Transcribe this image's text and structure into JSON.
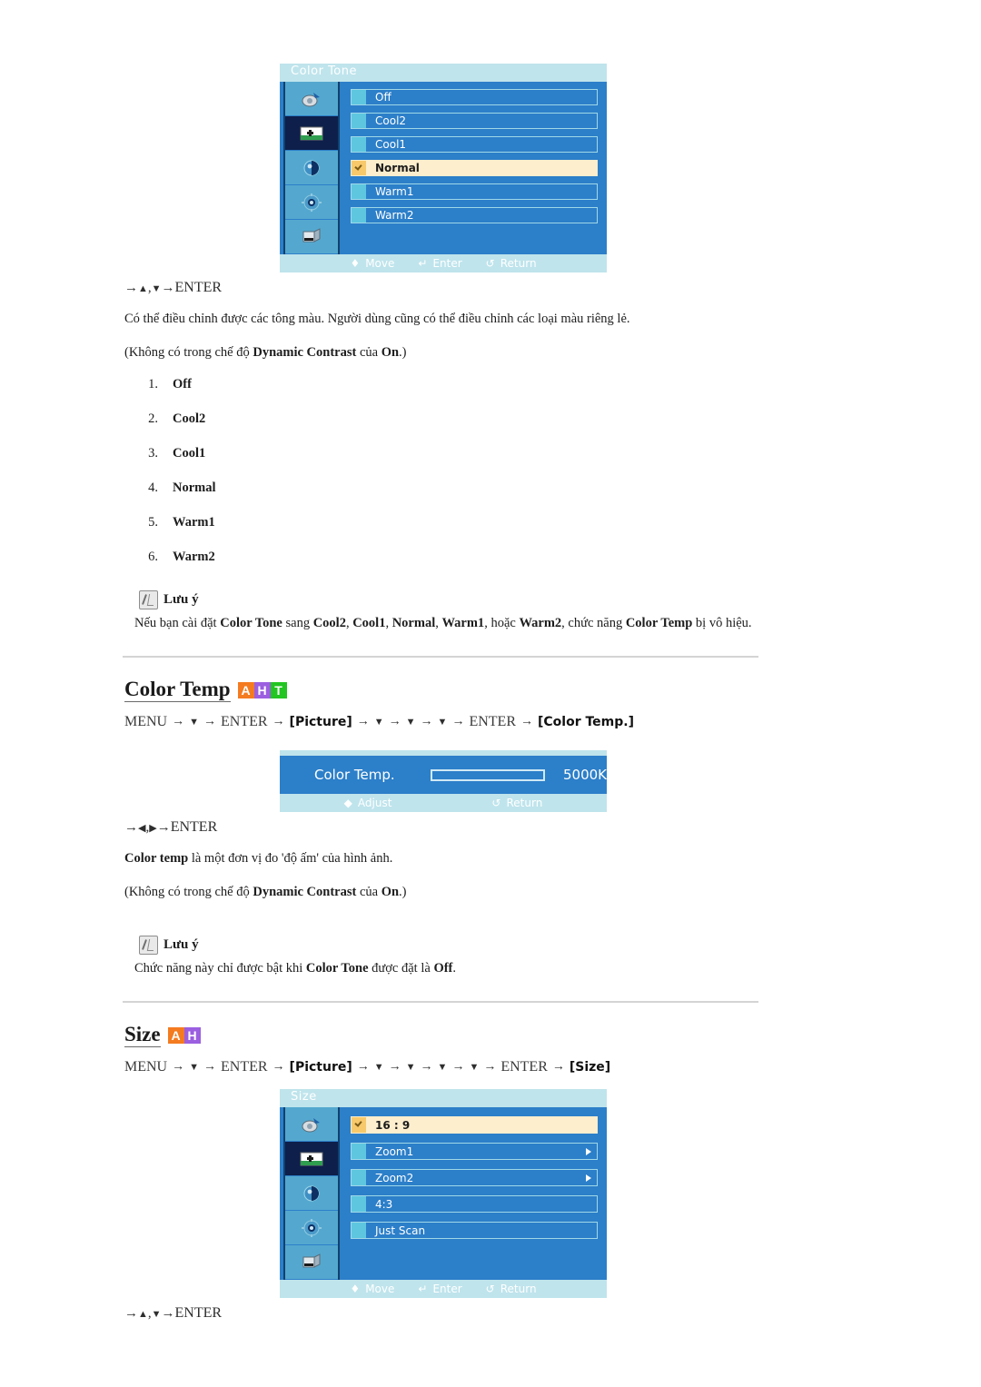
{
  "osd_color_tone": {
    "title": "Color Tone",
    "items": [
      {
        "label": "Off",
        "selected": false,
        "submenu": false
      },
      {
        "label": "Cool2",
        "selected": false,
        "submenu": false
      },
      {
        "label": "Cool1",
        "selected": false,
        "submenu": false
      },
      {
        "label": "Normal",
        "selected": true,
        "submenu": false
      },
      {
        "label": "Warm1",
        "selected": false,
        "submenu": false
      },
      {
        "label": "Warm2",
        "selected": false,
        "submenu": false
      }
    ],
    "sidebar_icons": [
      {
        "name": "input-source-icon",
        "selected": false
      },
      {
        "name": "picture-icon",
        "selected": true
      },
      {
        "name": "sound-icon",
        "selected": false
      },
      {
        "name": "setup-icon",
        "selected": false
      },
      {
        "name": "multi-control-icon",
        "selected": false
      }
    ],
    "footer": [
      {
        "glyph": "♦",
        "label": "Move"
      },
      {
        "glyph": "↵",
        "label": "Enter"
      },
      {
        "glyph": "↺",
        "label": "Return"
      }
    ]
  },
  "color_tone_section": {
    "nav_line": {
      "arrow": "→",
      "up": "▲",
      "sep": ",",
      "down": "▼",
      "arrow2": "→",
      "enter": "ENTER"
    },
    "paragraph1": "Có thể điều chỉnh được các tông màu. Người dùng cũng có thể điều chỉnh các loại màu riêng lẻ.",
    "paragraph2_pre": "(Không có trong chế độ ",
    "paragraph2_b1": "Dynamic Contrast",
    "paragraph2_mid": " của ",
    "paragraph2_b2": "On",
    "paragraph2_post": ".)",
    "list": [
      {
        "n": "1.",
        "t": "Off"
      },
      {
        "n": "2.",
        "t": "Cool2"
      },
      {
        "n": "3.",
        "t": "Cool1"
      },
      {
        "n": "4.",
        "t": "Normal"
      },
      {
        "n": "5.",
        "t": "Warm1"
      },
      {
        "n": "6.",
        "t": "Warm2"
      }
    ],
    "note_label": "Lưu ý",
    "note_pre": "Nếu bạn cài đặt ",
    "note_b1": "Color Tone",
    "note_m1": " sang ",
    "note_b2": "Cool2",
    "note_m2": ", ",
    "note_b3": "Cool1",
    "note_m3": ", ",
    "note_b4": "Normal",
    "note_m4": ", ",
    "note_b5": "Warm1",
    "note_m5": ", hoặc ",
    "note_b6": "Warm2",
    "note_m6": ", chức năng ",
    "note_b7": "Color Temp",
    "note_post": " bị vô hiệu."
  },
  "color_temp_section": {
    "title": "Color Temp",
    "badges": [
      {
        "letter": "A",
        "color": "#F47B20"
      },
      {
        "letter": "H",
        "color": "#9B5FE0"
      },
      {
        "letter": "T",
        "color": "#22C522"
      }
    ],
    "menu_path": {
      "menu": "MENU",
      "enter1": "ENTER",
      "picture": "[Picture]",
      "enter2": "ENTER",
      "target": "[Color Temp.]",
      "down_count_1": 1,
      "down_count_2": 3
    },
    "osd": {
      "label": "Color  Temp.",
      "value": "5000K",
      "footer": [
        {
          "glyph": "◆",
          "label": "Adjust"
        },
        {
          "glyph": "↺",
          "label": "Return"
        }
      ]
    },
    "nav_line": {
      "arrow": "→",
      "left": "◀",
      "sep": ",",
      "right": "▶",
      "arrow2": "→",
      "enter": "ENTER"
    },
    "paragraph1_b": "Color temp",
    "paragraph1_rest": " là một đơn vị đo 'độ ấm' của hình ảnh.",
    "paragraph2_pre": "(Không có trong chế độ ",
    "paragraph2_b1": "Dynamic Contrast",
    "paragraph2_mid": " của ",
    "paragraph2_b2": "On",
    "paragraph2_post": ".)",
    "note_label": "Lưu ý",
    "note_pre": "Chức năng này chỉ được bật khi ",
    "note_b1": "Color Tone",
    "note_mid": " được đặt là ",
    "note_b2": "Off",
    "note_post": "."
  },
  "size_section": {
    "title": "Size",
    "badges": [
      {
        "letter": "A",
        "color": "#F47B20"
      },
      {
        "letter": "H",
        "color": "#9B5FE0"
      }
    ],
    "menu_path": {
      "menu": "MENU",
      "enter1": "ENTER",
      "picture": "[Picture]",
      "enter2": "ENTER",
      "target": "[Size]",
      "down_count_1": 1,
      "down_count_2": 4
    },
    "osd": {
      "title": "Size",
      "items": [
        {
          "label": "16 : 9",
          "selected": true,
          "submenu": false
        },
        {
          "label": "Zoom1",
          "selected": false,
          "submenu": true
        },
        {
          "label": "Zoom2",
          "selected": false,
          "submenu": true
        },
        {
          "label": "4:3",
          "selected": false,
          "submenu": false
        },
        {
          "label": "Just  Scan",
          "selected": false,
          "submenu": false
        }
      ],
      "footer": [
        {
          "glyph": "♦",
          "label": "Move"
        },
        {
          "glyph": "↵",
          "label": "Enter"
        },
        {
          "glyph": "↺",
          "label": "Return"
        }
      ]
    },
    "nav_line": {
      "arrow": "→",
      "up": "▲",
      "sep": ",",
      "down": "▼",
      "arrow2": "→",
      "enter": "ENTER"
    }
  }
}
